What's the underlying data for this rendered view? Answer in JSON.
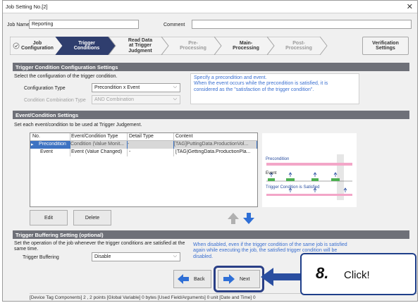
{
  "window": {
    "title": "Job Setting No.[2]",
    "close_icon": "close-icon"
  },
  "job": {
    "name_label": "Job Name",
    "name_value": "Reporting",
    "comment_label": "Comment",
    "comment_value": ""
  },
  "steps": [
    {
      "line1": "Job",
      "line2": "Configuration",
      "line3": "",
      "state": "done"
    },
    {
      "line1": "Trigger",
      "line2": "Conditions",
      "line3": "",
      "state": "active"
    },
    {
      "line1": "Read Data",
      "line2": "at Trigger",
      "line3": "Judgment",
      "state": "done"
    },
    {
      "line1": "Pre-",
      "line2": "Processing",
      "line3": "",
      "state": "future"
    },
    {
      "line1": "Main-",
      "line2": "Processing",
      "line3": "",
      "state": "done"
    },
    {
      "line1": "Post-",
      "line2": "Processing",
      "line3": "",
      "state": "future"
    },
    {
      "line1": "Verification",
      "line2": "Settings",
      "line3": "",
      "state": "verify"
    }
  ],
  "trigger_config": {
    "header": "Trigger Condition Configuration Settings",
    "instruction": "Select the configuration of the trigger condition.",
    "type_label": "Configuration Type",
    "type_value": "Precondition x Event",
    "combo_label": "Condition Combination Type",
    "combo_value": "AND Combination",
    "info": "Specify a precondition and event.\nWhen the event occurs while the precondition is satisfied, it is\nconsidered as the \"satisfaction of the trigger condition\"."
  },
  "event_settings": {
    "header": "Event/Condition Settings",
    "instruction": "Set each event/condition to be used at Trigger Judgement.",
    "columns": [
      "No.",
      "Event/Condition Type",
      "Detail Type",
      "Content"
    ],
    "rows": [
      {
        "no": "Precondition",
        "type": "Condition (Value Monit...",
        "detail": "-",
        "content": "[TAG]PuttingData.ProductionVol..."
      },
      {
        "no": "Event",
        "type": "Event (Value Changed)",
        "detail": "-",
        "content": "[TAG]GettingData.ProductionPla..."
      }
    ],
    "edit_label": "Edit",
    "delete_label": "Delete",
    "diagram": {
      "precondition_label": "Precondition",
      "event_label": "Event",
      "satisfied_label": "Trigger Condition is Satisfied"
    }
  },
  "buffering": {
    "header": "Trigger Buffering Setting (optional)",
    "instruction": "Set the operation of the job whenever the trigger conditions are satisfied at the same time.",
    "label": "Trigger Buffering",
    "value": "Disable",
    "info": "When disabled, even if the trigger condition of the same job is satisfied\nagain while executing the job, the satisfied trigger condition will be\ndisabled."
  },
  "nav": {
    "back_label": "Back",
    "next_label": "Next"
  },
  "status_bar": "[Device Tag Components] 2 , 2 points  [Global Variable] 0 bytes  [Used Field/Arguments] 0 unit  [Date and Time] 0",
  "callout": {
    "number": "8.",
    "text": "Click!"
  },
  "colors": {
    "active_step": "#2f3e6e",
    "header": "#6e7078",
    "accent": "#1f3f8a",
    "selected_row": "#3d73c2",
    "info_text": "#3a6fd0",
    "callout_arrow": "#2a4ea0"
  }
}
